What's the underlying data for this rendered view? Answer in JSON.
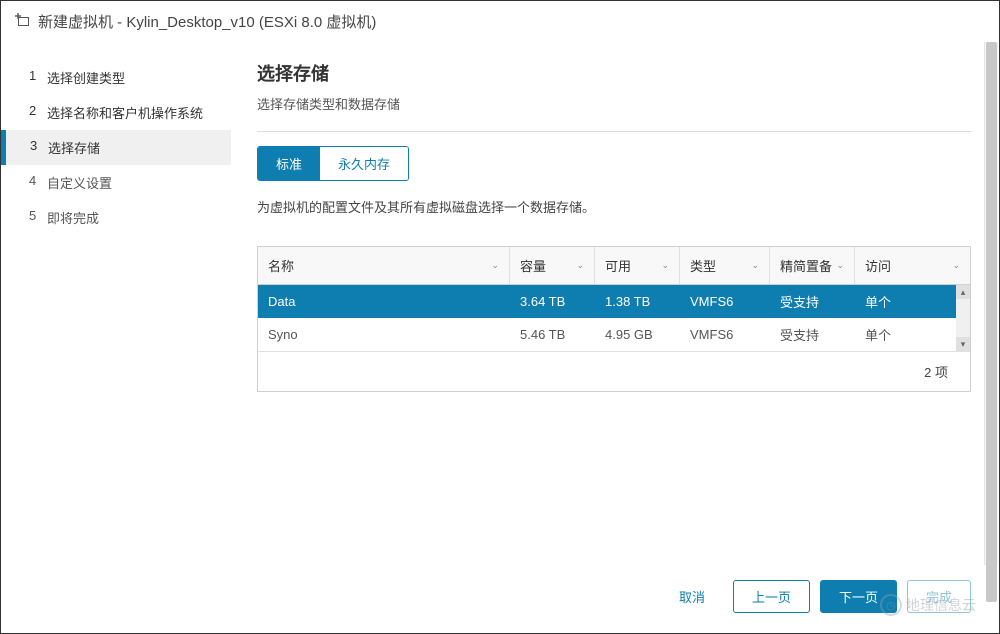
{
  "dialog": {
    "title": "新建虚拟机 - Kylin_Desktop_v10 (ESXi 8.0 虚拟机)"
  },
  "steps": [
    {
      "num": "1",
      "label": "选择创建类型"
    },
    {
      "num": "2",
      "label": "选择名称和客户机操作系统"
    },
    {
      "num": "3",
      "label": "选择存储"
    },
    {
      "num": "4",
      "label": "自定义设置"
    },
    {
      "num": "5",
      "label": "即将完成"
    }
  ],
  "main": {
    "heading": "选择存储",
    "subtitle": "选择存储类型和数据存储",
    "tabs": {
      "standard": "标准",
      "pmem": "永久内存"
    },
    "hint": "为虚拟机的配置文件及其所有虚拟磁盘选择一个数据存储。"
  },
  "table": {
    "cols": {
      "name": "名称",
      "capacity": "容量",
      "available": "可用",
      "type": "类型",
      "thin": "精简置备",
      "access": "访问"
    },
    "rows": [
      {
        "name": "Data",
        "capacity": "3.64 TB",
        "available": "1.38 TB",
        "type": "VMFS6",
        "thin": "受支持",
        "access": "单个"
      },
      {
        "name": "Syno",
        "capacity": "5.46 TB",
        "available": "4.95 GB",
        "type": "VMFS6",
        "thin": "受支持",
        "access": "单个"
      }
    ],
    "footer": "2 项"
  },
  "buttons": {
    "cancel": "取消",
    "back": "上一页",
    "next": "下一页",
    "finish": "完成"
  },
  "watermark": "地理信息云"
}
